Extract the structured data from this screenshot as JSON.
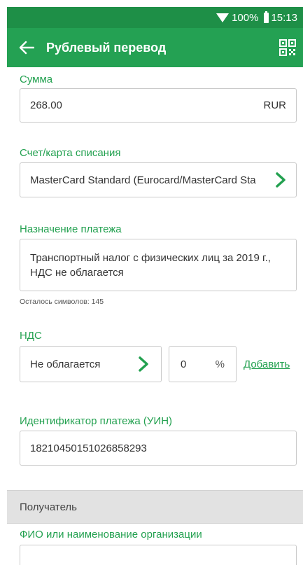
{
  "status": {
    "battery_percent": "100%",
    "time": "15:13"
  },
  "header": {
    "title": "Рублевый перевод",
    "back_icon": "arrow-back-icon",
    "qr_icon": "qr-code-icon"
  },
  "amount": {
    "label": "Сумма",
    "value": "268.00",
    "currency": "RUR"
  },
  "account": {
    "label": "Счет/карта списания",
    "value": "MasterCard Standard (Eurocard/MasterCard Sta"
  },
  "purpose": {
    "label": "Назначение платежа",
    "line1": "Транспортный налог с физических лиц за 2019 г.,",
    "line2": "НДС не облагается",
    "chars_left": "Осталось символов: 145"
  },
  "vat": {
    "label": "НДС",
    "type": "Не облагается",
    "rate": "0",
    "percent_sign": "%",
    "add_link": "Добавить"
  },
  "uin": {
    "label": "Идентификатор платежа (УИН)",
    "value": "18210450151026858293"
  },
  "recipient": {
    "section_title": "Получатель",
    "name_label": "ФИО или наименование организации",
    "name_value": ""
  },
  "colors": {
    "statusbar": "#1e8f47",
    "appbar": "#24a153",
    "accent": "#23a150"
  }
}
